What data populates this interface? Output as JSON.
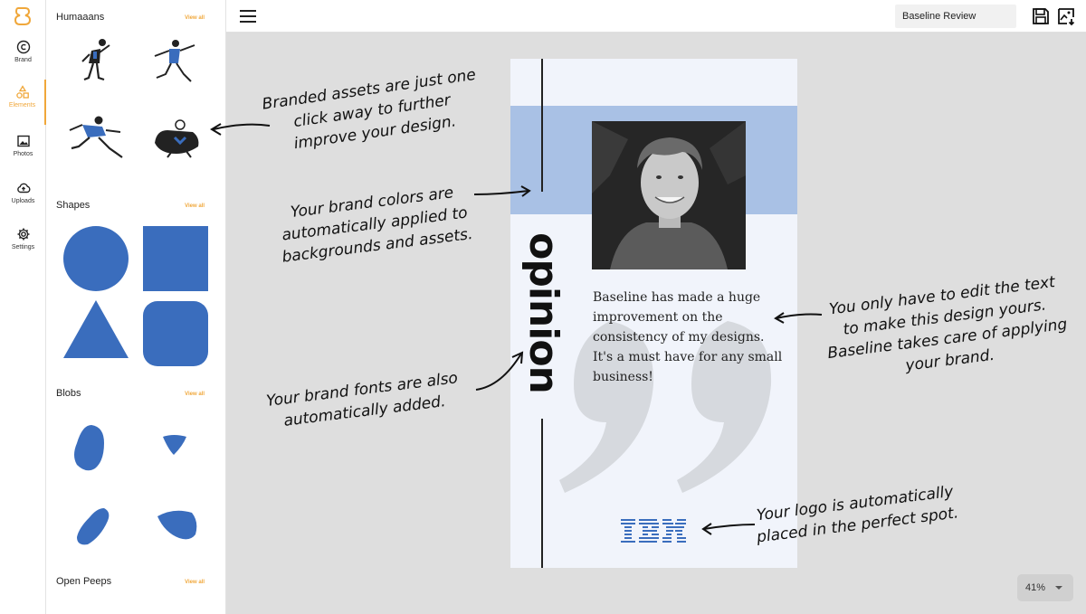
{
  "rail": {
    "items": [
      {
        "label": "Brand",
        "icon": "copyright-icon"
      },
      {
        "label": "Elements",
        "icon": "shapes-icon",
        "active": true
      },
      {
        "label": "Photos",
        "icon": "image-icon"
      },
      {
        "label": "Uploads",
        "icon": "cloud-upload-icon"
      },
      {
        "label": "Settings",
        "icon": "gear-icon"
      }
    ]
  },
  "panel": {
    "sections": [
      {
        "title": "Humaaans",
        "view_all": "View all"
      },
      {
        "title": "Shapes",
        "view_all": "View all"
      },
      {
        "title": "Blobs",
        "view_all": "View all"
      },
      {
        "title": "Open Peeps",
        "view_all": "View all"
      }
    ]
  },
  "topbar": {
    "doc_title": "Baseline Review"
  },
  "card": {
    "vertical_word": "opinion",
    "quote": "Baseline has made a huge improvement on the consistency of my designs. It's a must have for any small business!"
  },
  "notes": {
    "assets": "Branded assets are just one\nclick away to further\nimprove your design.",
    "colors": "Your brand colors are\nautomatically applied to\nbackgrounds and assets.",
    "fonts": "Your brand fonts are also\nautomatically added.",
    "text": "You only have to edit the text\nto make this design yours.\nBaseline takes care of applying\nyour brand.",
    "logo": "Your logo is automatically\nplaced in the perfect spot."
  },
  "zoom": "41%",
  "colors": {
    "accent": "#f0a73a",
    "brand_blue": "#3a6dbd",
    "band_blue": "#a9c1e5"
  }
}
